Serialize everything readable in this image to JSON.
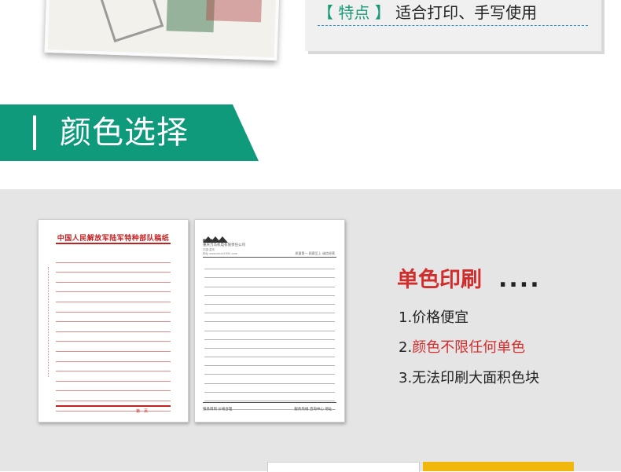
{
  "features": {
    "tag": "【 特点 】",
    "text": "适合打印、手写使用"
  },
  "section": {
    "title": "颜色选择"
  },
  "red_paper": {
    "title": "中国人民解放军陆军特种部队稿纸",
    "footer": "第　页"
  },
  "gray_paper": {
    "logo_name": "KEIVA",
    "company": "重庆万马机电有限责任公司",
    "meta": "中国·重庆",
    "meta2": "网址 www.keiva1981.com",
    "right_text": "质量第一  顾客至上  诚信经营",
    "footer_left": "服务周到  价格合理",
    "footer_right": "服务热线  咨询中心  地址 ..."
  },
  "mono": {
    "title": "单色印刷",
    "dots": "....",
    "point1": "1.价格便宜",
    "point2_num": "2.",
    "point2_text": "颜色不限任何单色",
    "point3": "3.无法印刷大面积色块"
  },
  "colors": {
    "accent_green": "#0e9a7b",
    "red": "#d22d2d",
    "panel_gray": "#e5e5e5",
    "yellow": "#f2b70d"
  }
}
